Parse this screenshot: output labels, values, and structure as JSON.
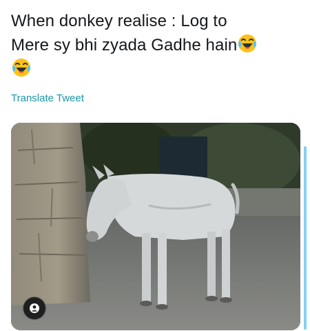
{
  "tweet": {
    "line1": "When donkey realise : Log to",
    "line2": "Mere sy bhi zyada Gadhe hain",
    "emoji": "face-with-tears-of-joy",
    "translate_label": "Translate Tweet"
  },
  "media": {
    "subject": "donkey-photo",
    "attribution_icon": "person-icon"
  },
  "colors": {
    "link": "#1b95a8",
    "scrollbar": "#86cff2",
    "text": "#14171a"
  }
}
